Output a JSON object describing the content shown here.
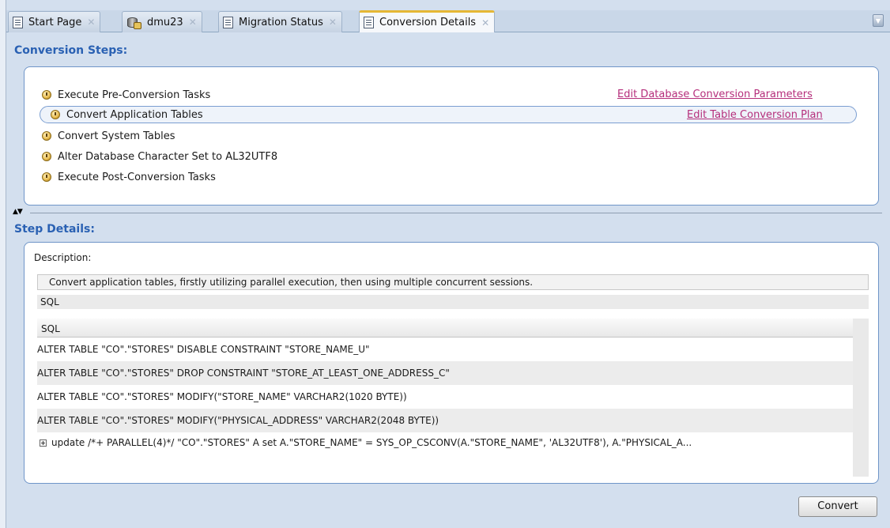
{
  "tabs": [
    {
      "label": "Start Page",
      "icon": "document-icon",
      "active": false
    },
    {
      "label": "dmu23",
      "icon": "database-icon",
      "active": false
    },
    {
      "label": "Migration Status",
      "icon": "document-icon",
      "active": false
    },
    {
      "label": "Conversion Details",
      "icon": "document-icon",
      "active": true
    }
  ],
  "conversion_steps": {
    "title": "Conversion Steps:",
    "steps": [
      {
        "label": "Execute Pre-Conversion Tasks",
        "selected": false
      },
      {
        "label": "Convert Application Tables",
        "selected": true
      },
      {
        "label": "Convert System Tables",
        "selected": false
      },
      {
        "label": "Alter Database Character Set to AL32UTF8",
        "selected": false
      },
      {
        "label": "Execute Post-Conversion Tasks",
        "selected": false
      }
    ],
    "links": {
      "edit_db_params": "Edit Database Conversion Parameters",
      "edit_table_plan": "Edit Table Conversion Plan"
    }
  },
  "step_details": {
    "title": "Step Details:",
    "description_label": "Description:",
    "description_text": "Convert application tables, firstly utilizing parallel execution, then using multiple concurrent sessions.",
    "sql_label": "SQL",
    "grid_header": "SQL",
    "rows": [
      "ALTER TABLE \"CO\".\"STORES\" DISABLE CONSTRAINT \"STORE_NAME_U\"",
      "ALTER TABLE \"CO\".\"STORES\" DROP CONSTRAINT \"STORE_AT_LEAST_ONE_ADDRESS_C\"",
      "ALTER TABLE \"CO\".\"STORES\" MODIFY(\"STORE_NAME\" VARCHAR2(1020 BYTE))",
      "ALTER TABLE \"CO\".\"STORES\" MODIFY(\"PHYSICAL_ADDRESS\" VARCHAR2(2048 BYTE))",
      "update /*+ PARALLEL(4)*/ \"CO\".\"STORES\" A  set A.\"STORE_NAME\" = SYS_OP_CSCONV(A.\"STORE_NAME\", 'AL32UTF8'), A.\"PHYSICAL_A..."
    ]
  },
  "convert_button": "Convert"
}
